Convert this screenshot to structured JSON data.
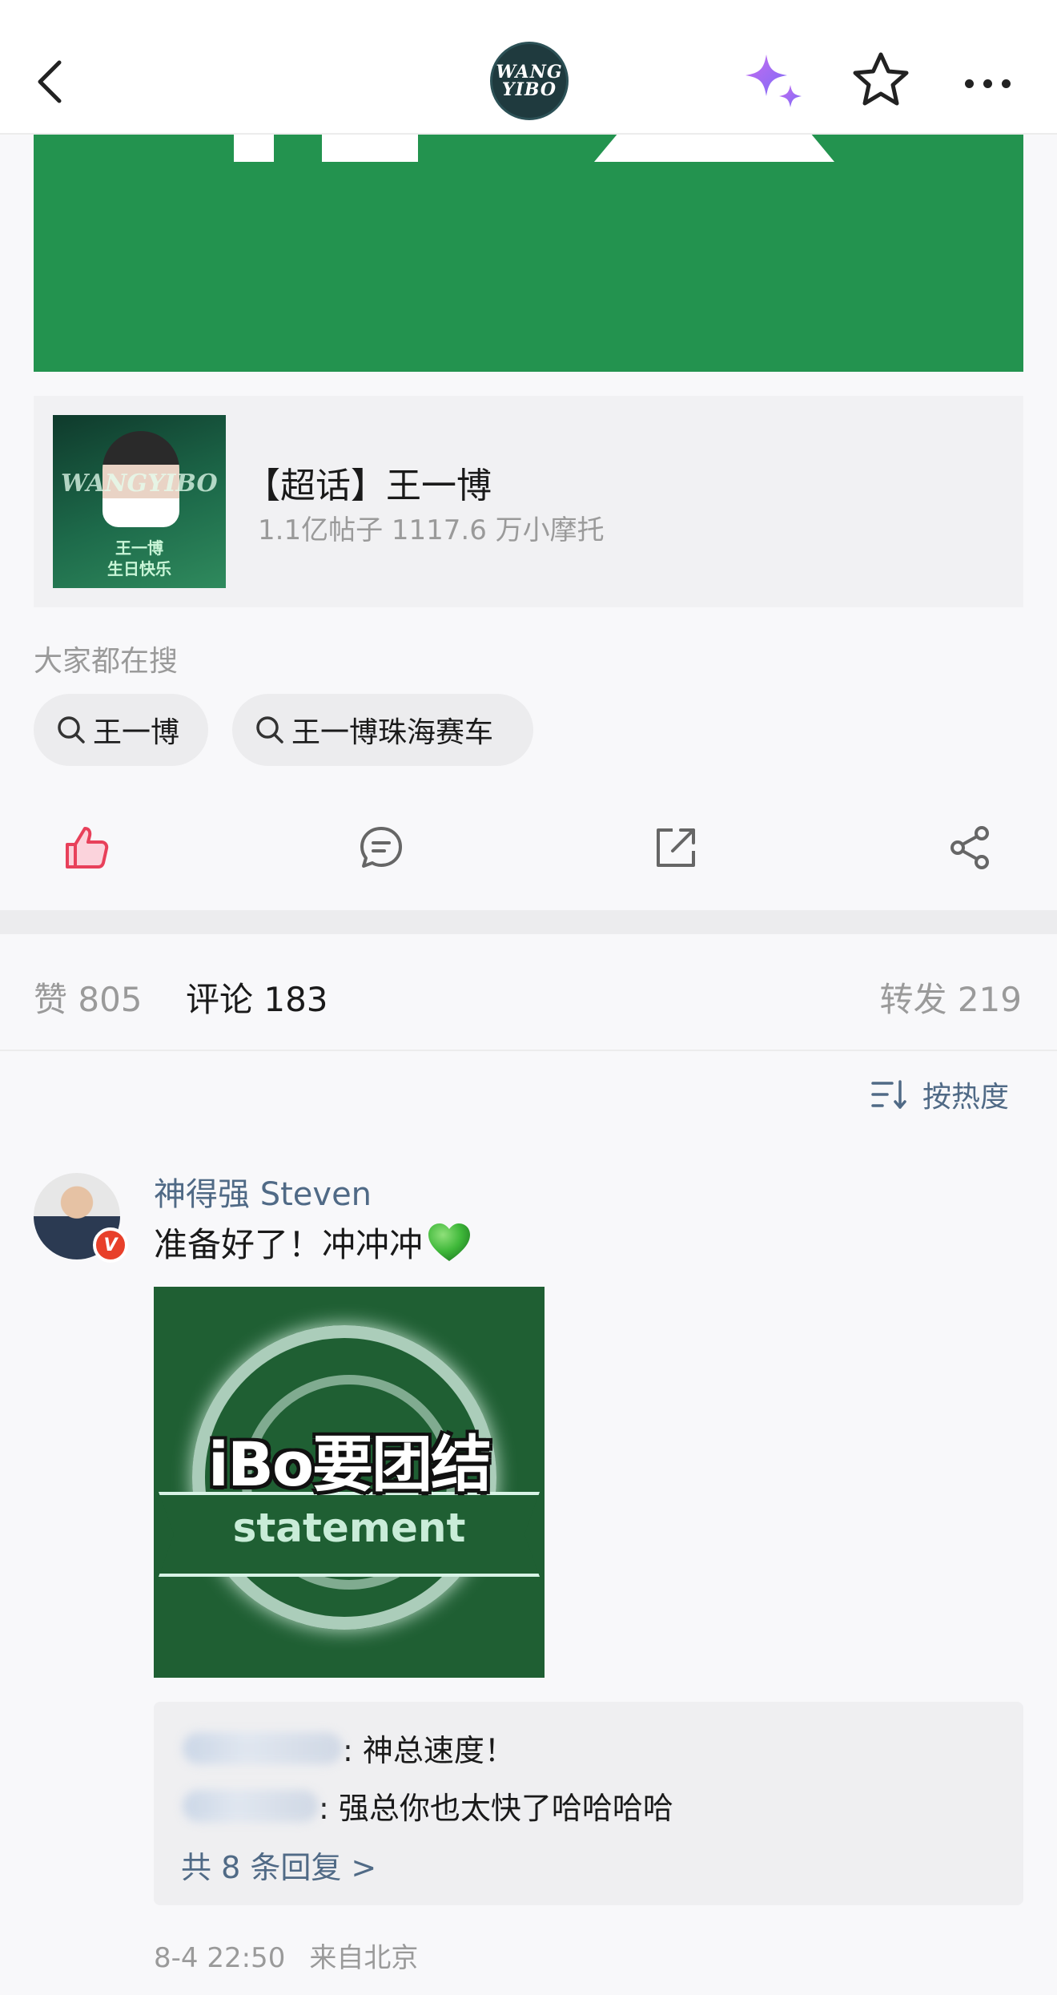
{
  "header": {
    "logo_line1": "WANG",
    "logo_line2": "YIBO",
    "icons": {
      "back": "chevron-left-icon",
      "ai": "sparkle-icon",
      "favorite": "star-outline-icon",
      "more": "more-horizontal-icon"
    },
    "ai_gradient": [
      "#c86bf0",
      "#7b6cf6"
    ]
  },
  "post_image": {
    "color": "#23934f"
  },
  "topic_card": {
    "title": "【超话】王一博",
    "stats": "1.1亿帖子 1117.6 万小摩托",
    "thumb_watermark": "WANGYIBO",
    "thumb_caption_line1": "王一博",
    "thumb_caption_line2": "生日快乐"
  },
  "search": {
    "heading": "大家都在搜",
    "chips": [
      {
        "label": "王一博"
      },
      {
        "label": "王一博珠海赛车"
      }
    ]
  },
  "actions": {
    "like_icon": "thumbs-up-icon",
    "comment_icon": "comment-icon",
    "repost_icon": "repost-icon",
    "share_icon": "share-icon",
    "like_color": "#e8405a"
  },
  "tabs": {
    "likes": "赞 805",
    "comments": "评论 183",
    "reposts": "转发 219",
    "active": "comments",
    "accent": "#e8405a"
  },
  "sort": {
    "label": "按热度",
    "icon": "sort-icon"
  },
  "comment": {
    "author": "神得强 Steven",
    "verified_mark": "V",
    "text": "准备好了！冲冲冲",
    "emoji": "green-heart-icon",
    "image_title": "iBo要团结",
    "image_subtitle": "statement",
    "replies": [
      {
        "text": ": 神总速度！"
      },
      {
        "text": ": 强总你也太快了哈哈哈哈"
      }
    ],
    "more_replies": "共 8 条回复 >",
    "time": "8-4 22:50",
    "location": "来自北京"
  }
}
